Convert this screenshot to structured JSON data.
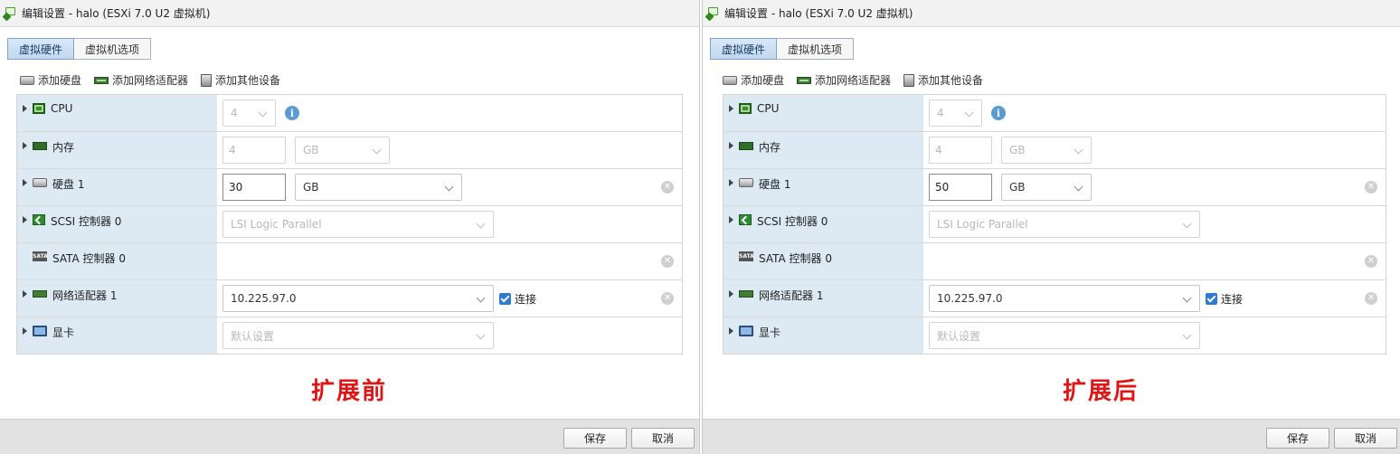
{
  "panels": [
    {
      "title": "编辑设置 - halo (ESXi 7.0 U2 虚拟机)",
      "tabs": [
        "虚拟硬件",
        "虚拟机选项"
      ],
      "toolbar": [
        "添加硬盘",
        "添加网络适配器",
        "添加其他设备"
      ],
      "cpu": {
        "label": "CPU",
        "value": "4"
      },
      "memory": {
        "label": "内存",
        "value": "4",
        "unit": "GB"
      },
      "disk": {
        "label": "硬盘 1",
        "value": "30",
        "unit": "GB"
      },
      "scsi": {
        "label": "SCSI 控制器 0",
        "value": "LSI Logic Parallel"
      },
      "sata": {
        "label": "SATA 控制器 0",
        "icon_text": "SATA"
      },
      "nic": {
        "label": "网络适配器 1",
        "value": "10.225.97.0",
        "connect": "连接"
      },
      "video": {
        "label": "显卡",
        "value": "默认设置"
      },
      "caption": "扩展前",
      "buttons": {
        "save": "保存",
        "cancel": "取消"
      }
    },
    {
      "title": "编辑设置 - halo (ESXi 7.0 U2 虚拟机)",
      "tabs": [
        "虚拟硬件",
        "虚拟机选项"
      ],
      "toolbar": [
        "添加硬盘",
        "添加网络适配器",
        "添加其他设备"
      ],
      "cpu": {
        "label": "CPU",
        "value": "4"
      },
      "memory": {
        "label": "内存",
        "value": "4",
        "unit": "GB"
      },
      "disk": {
        "label": "硬盘 1",
        "value": "50",
        "unit": "GB"
      },
      "scsi": {
        "label": "SCSI 控制器 0",
        "value": "LSI Logic Parallel"
      },
      "sata": {
        "label": "SATA 控制器 0",
        "icon_text": "SATA"
      },
      "nic": {
        "label": "网络适配器 1",
        "value": "10.225.97.0",
        "connect": "连接"
      },
      "video": {
        "label": "显卡",
        "value": "默认设置"
      },
      "caption": "扩展后",
      "buttons": {
        "save": "保存",
        "cancel": "取消"
      }
    }
  ]
}
